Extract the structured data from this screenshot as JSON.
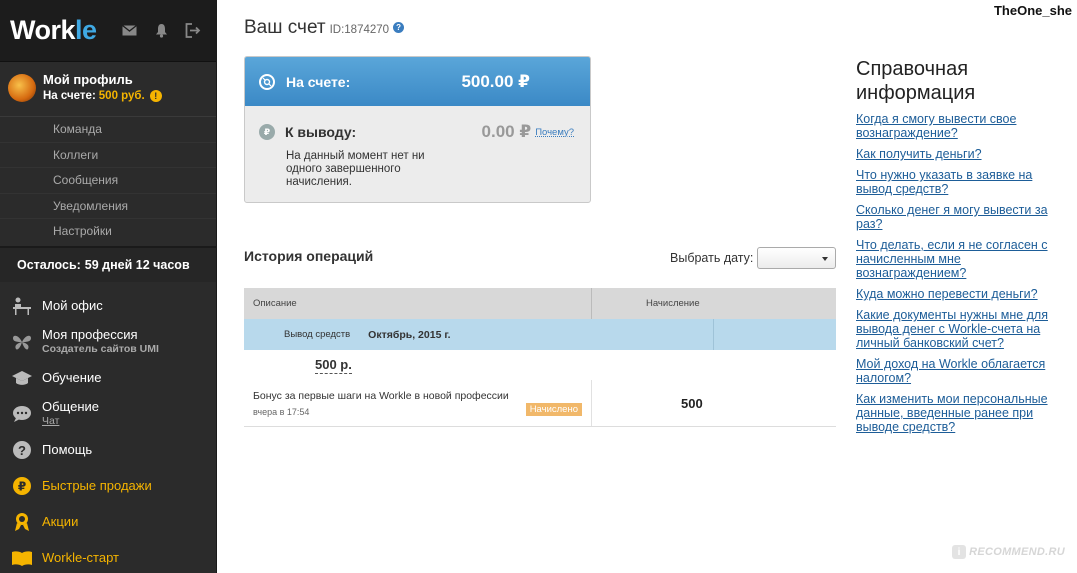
{
  "app": {
    "logo_main": "Work",
    "logo_accent": "le"
  },
  "topbar": {
    "icons": [
      "mail-icon",
      "bell-icon",
      "logout-icon"
    ]
  },
  "profile": {
    "name": "Мой профиль",
    "balance_label": "На счете:",
    "balance_value": "500 руб.",
    "warn": "!"
  },
  "subnav": [
    {
      "label": "Команда"
    },
    {
      "label": "Коллеги"
    },
    {
      "label": "Сообщения"
    },
    {
      "label": "Уведомления"
    },
    {
      "label": "Настройки"
    }
  ],
  "remaining": {
    "label": "Осталось:",
    "value": "59 дней 12 часов"
  },
  "nav": [
    {
      "label": "Мой офис",
      "icon": "desk-icon"
    },
    {
      "label": "Моя профессия",
      "sub": "Создатель сайтов UMI",
      "icon": "butterfly-icon"
    },
    {
      "label": "Обучение",
      "icon": "graduation-cap-icon"
    },
    {
      "label": "Общение",
      "sub": "Чат",
      "icon": "chat-icon"
    },
    {
      "label": "Помощь",
      "icon": "help-icon"
    },
    {
      "label": "Быстрые продажи",
      "icon": "ruble-coin-icon"
    },
    {
      "label": "Акции",
      "icon": "award-icon"
    },
    {
      "label": "Workle-старт",
      "icon": "book-icon"
    }
  ],
  "account": {
    "title": "Ваш счет",
    "id": "ID:1874270",
    "help": "?",
    "on_account_label": "На счете:",
    "on_account_value": "500.00 ₽",
    "withdraw_label": "К выводу:",
    "withdraw_value": "0.00 ₽",
    "why_link": "Почему?",
    "withdraw_note": "На данный момент нет ни одного завершенного начисления."
  },
  "history": {
    "title": "История операций",
    "date_label": "Выбрать дату:",
    "date_value": "",
    "col_description": "Описание",
    "col_accrual": "Начисление",
    "group_type": "Вывод средств",
    "group_month": "Октябрь, 2015 г.",
    "group_sum": "500 р.",
    "ops": [
      {
        "name": "Бонус за первые шаги на Workle в новой профессии",
        "time": "вчера в 17:54",
        "status": "Начислено",
        "amount": "500"
      }
    ]
  },
  "info": {
    "title": "Справочная информация",
    "links": [
      "Когда я смогу вывести свое вознаграждение?",
      "Как получить деньги?",
      "Что нужно указать в заявке на вывод средств?",
      "Сколько денег я могу вывести за раз?",
      "Что делать, если я не согласен с начисленным мне вознаграждением?",
      "Куда можно перевести деньги?",
      "Какие документы нужны мне для вывода денег с Workle-счета на личный банковский счет?",
      "Мой доход на Workle облагается налогом?",
      "Как изменить мои персональные данные, введенные ранее при выводе средств?"
    ]
  },
  "watermark": {
    "user": "TheOne_she",
    "site": "RECOMMEND.RU",
    "site_mark": "i"
  },
  "colors": {
    "accent": "#3fa9e4",
    "yellow": "#f5b400",
    "link": "#1d5d98",
    "sidebar": "#2b2b2b"
  }
}
